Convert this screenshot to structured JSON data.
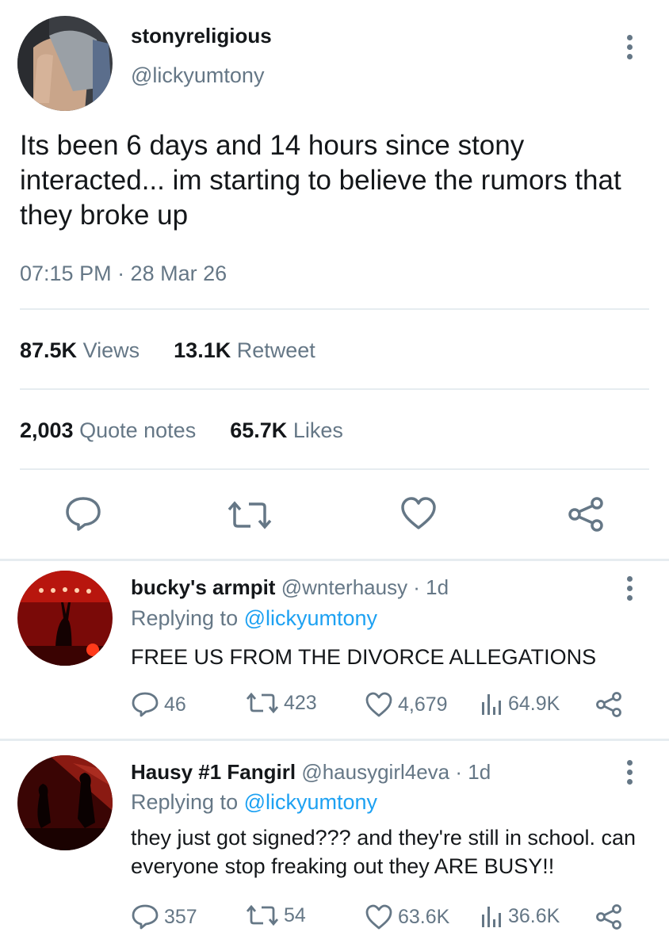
{
  "main_tweet": {
    "display_name": "stonyreligious",
    "handle": "@lickyumtony",
    "text": "Its been 6 days and 14 hours since stony interacted... im starting to believe the rumors that they broke up",
    "timestamp": "07:15 PM · 28 Mar 26",
    "stats_row1": {
      "views_value": "87.5K",
      "views_label": "Views",
      "retweets_value": "13.1K",
      "retweets_label": "Retweet"
    },
    "stats_row2": {
      "quotes_value": "2,003",
      "quotes_label": "Quote notes",
      "likes_value": "65.7K",
      "likes_label": "Likes"
    },
    "actions": [
      "reply-icon",
      "retweet-icon",
      "heart-icon",
      "share-icon"
    ]
  },
  "replies": [
    {
      "display_name": "bucky's armpit",
      "handle_time": "@wnterhausy · 1d",
      "replying_label": "Replying to",
      "replying_to": "@lickyumtony",
      "text": "FREE US FROM THE DIVORCE ALLEGATIONS",
      "replies": "46",
      "retweets": "423",
      "likes": "4,679",
      "views": "64.9K"
    },
    {
      "display_name": "Hausy #1 Fangirl",
      "handle_time": "@hausygirl4eva · 1d",
      "replying_label": "Replying to",
      "replying_to": "@lickyumtony",
      "text": "they just got signed??? and they're still in school. can everyone stop freaking out they ARE BUSY!!",
      "replies": "357",
      "retweets": "54",
      "likes": "63.6K",
      "views": "36.6K"
    }
  ],
  "colors": {
    "text": "#14171a",
    "secondary": "#657786",
    "link": "#1da1f2",
    "divider": "#e6ecf0"
  }
}
